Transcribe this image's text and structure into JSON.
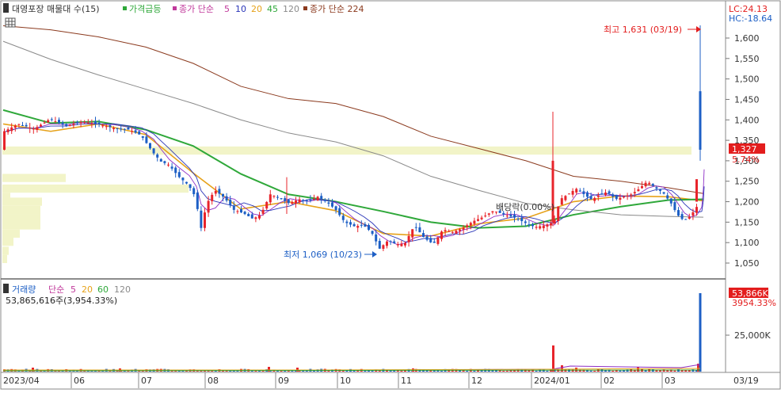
{
  "legend_top": {
    "stock": "대영포장 매물대 수(15)",
    "price_surge": "가격급등",
    "ma_label": "종가 단순",
    "ma_periods": [
      "5",
      "10",
      "20",
      "45",
      "120"
    ],
    "ma224_label": "종가 단순 224"
  },
  "legend_bottom": {
    "volume": "거래량",
    "ma_label": "단순",
    "ma_periods": [
      "5",
      "20",
      "60",
      "120"
    ],
    "volume_text": "53,865,616주(3,954.33%)"
  },
  "corner": {
    "lc": "LC:24.13",
    "hc": "HC:-18.64"
  },
  "annotations": {
    "high": "최고 1,631 (03/19)",
    "low": "최저 1,069 (10/23)",
    "dividend": "배당락(0.00%)"
  },
  "price_tag": {
    "value": "1,327",
    "change": "5.74%"
  },
  "volume_tag": {
    "value": "53,866K",
    "change": "3954.33%"
  },
  "colors": {
    "up": "#e8242b",
    "down": "#1d5fc5",
    "ma5": "#8e2fc6",
    "ma10": "#2a35b8",
    "ma20": "#e6a21a",
    "ma45": "#2fa83a",
    "ma120": "#8a8a8a",
    "ma224": "#8b3a1e",
    "tag": "#e31d1d",
    "profile": "#f2f4c8"
  },
  "chart_data": {
    "type": "candlestick",
    "y_ticks": [
      "1,050",
      "1,100",
      "1,150",
      "1,200",
      "1,250",
      "1,300",
      "1,350",
      "1,400",
      "1,450",
      "1,500",
      "1,550",
      "1,600"
    ],
    "y_range": [
      1020,
      1660
    ],
    "volume_ticks": [
      "25,000K"
    ],
    "x_labels": [
      "2023/04",
      "06",
      "07",
      "08",
      "09",
      "10",
      "11",
      "12",
      "2024/01",
      "02",
      "03",
      "03/19"
    ],
    "price_series": [
      [
        0,
        1370
      ],
      [
        20,
        1390
      ],
      [
        40,
        1378
      ],
      [
        60,
        1402
      ],
      [
        80,
        1385
      ],
      [
        100,
        1395
      ],
      [
        120,
        1390
      ],
      [
        140,
        1380
      ],
      [
        160,
        1376
      ],
      [
        175,
        1362
      ],
      [
        190,
        1320
      ],
      [
        200,
        1298
      ],
      [
        210,
        1290
      ],
      [
        222,
        1262
      ],
      [
        235,
        1240
      ],
      [
        244,
        1210
      ],
      [
        250,
        1130
      ],
      [
        258,
        1196
      ],
      [
        268,
        1228
      ],
      [
        280,
        1210
      ],
      [
        292,
        1180
      ],
      [
        304,
        1172
      ],
      [
        316,
        1158
      ],
      [
        326,
        1168
      ],
      [
        338,
        1218
      ],
      [
        350,
        1208
      ],
      [
        362,
        1196
      ],
      [
        374,
        1206
      ],
      [
        386,
        1200
      ],
      [
        398,
        1212
      ],
      [
        410,
        1198
      ],
      [
        420,
        1182
      ],
      [
        432,
        1150
      ],
      [
        444,
        1140
      ],
      [
        456,
        1142
      ],
      [
        466,
        1125
      ],
      [
        476,
        1085
      ],
      [
        486,
        1104
      ],
      [
        498,
        1096
      ],
      [
        508,
        1098
      ],
      [
        520,
        1142
      ],
      [
        532,
        1112
      ],
      [
        544,
        1096
      ],
      [
        556,
        1132
      ],
      [
        568,
        1126
      ],
      [
        580,
        1134
      ],
      [
        594,
        1152
      ],
      [
        606,
        1162
      ],
      [
        620,
        1178
      ],
      [
        634,
        1168
      ],
      [
        648,
        1160
      ],
      [
        660,
        1148
      ],
      [
        672,
        1138
      ],
      [
        684,
        1142
      ],
      [
        696,
        1150
      ],
      [
        704,
        1206
      ],
      [
        714,
        1218
      ],
      [
        724,
        1232
      ],
      [
        734,
        1218
      ],
      [
        744,
        1204
      ],
      [
        754,
        1218
      ],
      [
        764,
        1224
      ],
      [
        774,
        1206
      ],
      [
        784,
        1212
      ],
      [
        794,
        1218
      ],
      [
        804,
        1232
      ],
      [
        814,
        1250
      ],
      [
        824,
        1234
      ],
      [
        834,
        1222
      ],
      [
        844,
        1196
      ],
      [
        852,
        1168
      ],
      [
        860,
        1154
      ],
      [
        868,
        1164
      ],
      [
        876,
        1186
      ],
      [
        882,
        1210
      ],
      [
        884,
        1300
      ],
      [
        885,
        1327
      ]
    ],
    "moving_averages": {
      "ma20": [
        [
          0,
          1390
        ],
        [
          60,
          1372
        ],
        [
          120,
          1390
        ],
        [
          180,
          1364
        ],
        [
          240,
          1270
        ],
        [
          300,
          1182
        ],
        [
          360,
          1200
        ],
        [
          420,
          1178
        ],
        [
          480,
          1122
        ],
        [
          540,
          1116
        ],
        [
          600,
          1146
        ],
        [
          660,
          1160
        ],
        [
          720,
          1200
        ],
        [
          780,
          1214
        ],
        [
          840,
          1212
        ],
        [
          884,
          1202
        ]
      ],
      "ma45": [
        [
          0,
          1424
        ],
        [
          60,
          1392
        ],
        [
          120,
          1396
        ],
        [
          180,
          1376
        ],
        [
          240,
          1336
        ],
        [
          300,
          1268
        ],
        [
          360,
          1218
        ],
        [
          420,
          1200
        ],
        [
          480,
          1176
        ],
        [
          540,
          1150
        ],
        [
          600,
          1136
        ],
        [
          660,
          1140
        ],
        [
          720,
          1168
        ],
        [
          780,
          1188
        ],
        [
          840,
          1204
        ],
        [
          884,
          1206
        ]
      ],
      "ma120": [
        [
          0,
          1592
        ],
        [
          60,
          1548
        ],
        [
          120,
          1510
        ],
        [
          180,
          1475
        ],
        [
          240,
          1440
        ],
        [
          300,
          1400
        ],
        [
          360,
          1368
        ],
        [
          420,
          1346
        ],
        [
          480,
          1312
        ],
        [
          540,
          1262
        ],
        [
          600,
          1228
        ],
        [
          660,
          1196
        ],
        [
          720,
          1180
        ],
        [
          780,
          1168
        ],
        [
          840,
          1164
        ],
        [
          884,
          1162
        ]
      ],
      "ma224": [
        [
          0,
          1630
        ],
        [
          60,
          1620
        ],
        [
          120,
          1603
        ],
        [
          180,
          1578
        ],
        [
          240,
          1538
        ],
        [
          300,
          1482
        ],
        [
          360,
          1452
        ],
        [
          420,
          1440
        ],
        [
          480,
          1408
        ],
        [
          540,
          1360
        ],
        [
          600,
          1330
        ],
        [
          660,
          1300
        ],
        [
          720,
          1262
        ],
        [
          780,
          1250
        ],
        [
          840,
          1234
        ],
        [
          884,
          1220
        ]
      ]
    }
  }
}
